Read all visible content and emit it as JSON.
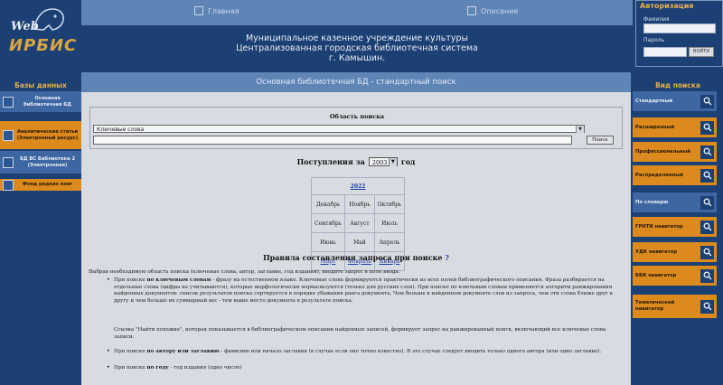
{
  "logo": {
    "web": "Web",
    "irbis": "ИРБИС"
  },
  "topnav": {
    "home": "Главная",
    "description": "Описание"
  },
  "header": {
    "line1": "Муниципальное казенное учреждение культуры",
    "line2": "Централизованная городская библиотечная система",
    "line3": "г. Камышин."
  },
  "auth": {
    "title": "Авторизация",
    "surname_label": "Фамилия",
    "password_label": "Пароль",
    "login_button": "ВОЙТИ"
  },
  "left": {
    "title": "Базы данных",
    "items": [
      {
        "label": "Основная библиотечная БД",
        "style": "blue"
      },
      {
        "label": "Аналитические статьи (Электронный ресурс)",
        "style": "orange"
      },
      {
        "label": "БД ВС Библиотека 2 (Электронная)",
        "style": "blue"
      },
      {
        "label": "Фонд редких книг",
        "style": "orange"
      }
    ]
  },
  "main": {
    "title": "Основная библиотечная БД - стандартный поиск",
    "area_label": "Область поиска",
    "area_value": "Ключевые слова",
    "search_button": "Поиск",
    "received_prefix": "Поступления за",
    "received_year": "2003",
    "received_suffix": "год",
    "calendar": {
      "year": "2022",
      "rows": [
        [
          "Декабрь",
          "Ноябрь",
          "Октябрь"
        ],
        [
          "Сентябрь",
          "Август",
          "Июль"
        ],
        [
          "Июнь",
          "Май",
          "Апрель"
        ],
        [
          "Март",
          "Февраль",
          "Январь"
        ]
      ]
    },
    "rules_title": "Правила составления запроса при поиске",
    "rules_q": "?",
    "intro": "Выбрав необходимую область поиска (ключевые слова, автор, заглавие, год издания), вводите запрос в поле ввода:",
    "b1_pre": "При поиске ",
    "b1_bold": "по ключевым словам",
    "b1_text": " - фразу на естественном языке. Ключевые слова формируются практически из всех полей библиографического описания. Фраза разбирается на отдельные слова (цифры не учитываются), которые морфологически нормализуются (только для русских слов). При поиске по ключевым словам применяется алгоритм ранжирования найденных документов: список результатов поиска сортируется в порядке убывания ранга документа. Чем больше в найденном документе слов из запроса, чем эти слова ближе друг к другу и чем больше их суммарный вес - тем выше место документа в результате поиска.",
    "note": "Ссылка \"Найти похожие\", которая показывается в библиографическом описании найденных записей, формирует запрос на ранжированный поиск, включающий все ключевые слова записи.",
    "b2_pre": "При поиске ",
    "b2_bold": "по автору или заглавию",
    "b2_text": " - фамилию или начало заглавия (в случае если оно точно известно). В это случае следует вводить только одного автора (или одно заглавие).",
    "b3_pre": "При поиске ",
    "b3_bold": "по году",
    "b3_text": " - год издания (одно число)"
  },
  "right": {
    "title": "Вид поиска",
    "items": [
      {
        "label": "Стандартный",
        "style": "blue"
      },
      {
        "label": "Расширенный",
        "style": "orange"
      },
      {
        "label": "Профессиональный",
        "style": "orange"
      },
      {
        "label": "Распределенный",
        "style": "orange"
      },
      {
        "label": "По словарю",
        "style": "blue"
      },
      {
        "label": "ГРНТИ навигатор",
        "style": "orange"
      },
      {
        "label": "УДК навигатор",
        "style": "orange"
      },
      {
        "label": "ББК навигатор",
        "style": "orange"
      },
      {
        "label": "Тематический навигатор",
        "style": "orange"
      }
    ]
  },
  "colors": {
    "dark_blue": "#1c3f74",
    "mid_blue": "#5f85b7",
    "orange": "#dc8a1e",
    "gold": "#e3b14d"
  }
}
